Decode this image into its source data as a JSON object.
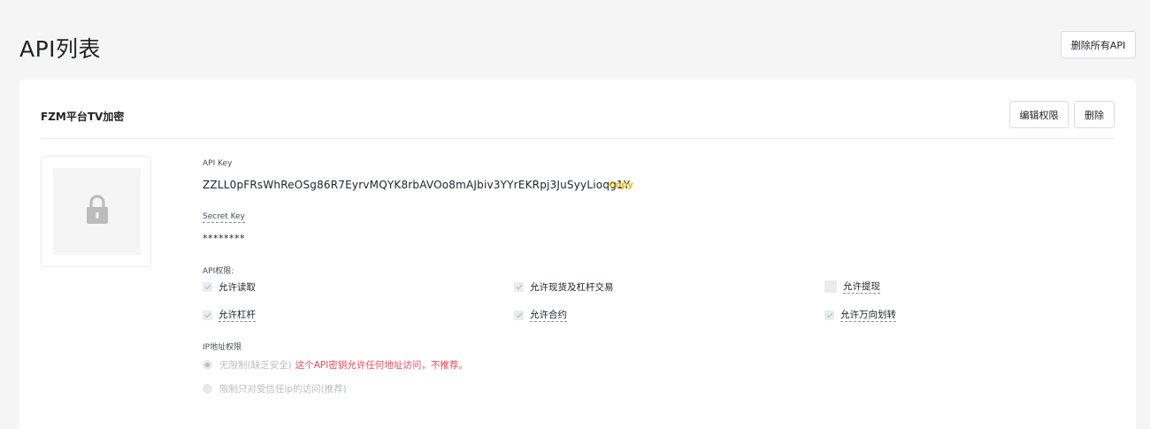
{
  "page": {
    "title": "API列表",
    "delete_all_label": "删除所有API"
  },
  "card": {
    "title": "FZM平台TV加密",
    "edit_label": "编辑权限",
    "delete_label": "删除",
    "api_key_label": "API Key",
    "api_key_value": "ZZLL0pFRsWhReOSg86R7EyrvMQYK8rbAVOo8mAJbiv3YYrEKRpj3JuSyyLioqg1Y",
    "copy_label": "Copy",
    "secret_key_label": "Secret Key",
    "secret_key_value": "********",
    "permissions_label": "API权限:",
    "permissions": [
      {
        "label": "允许读取",
        "checked": true
      },
      {
        "label": "允许现货及杠杆交易",
        "checked": true
      },
      {
        "label": "允许提现",
        "checked": false
      },
      {
        "label": "允许杠杆",
        "checked": true
      },
      {
        "label": "允许合约",
        "checked": true
      },
      {
        "label": "允许万向划转",
        "checked": true
      }
    ],
    "ip_label": "IP地址权限",
    "ip_options": [
      {
        "label": "无限制(缺乏安全)",
        "warning": "这个API密钥允许任何地址访问，不推荐。",
        "selected": true
      },
      {
        "label": "限制只对受信任ip的访问(推荐)",
        "warning": "",
        "selected": false
      }
    ]
  },
  "colors": {
    "accent": "#f0b90b",
    "danger": "#f6465d",
    "text": "#1e2329"
  },
  "icons": {
    "qr_placeholder": "lock-icon",
    "check": "check-icon"
  }
}
